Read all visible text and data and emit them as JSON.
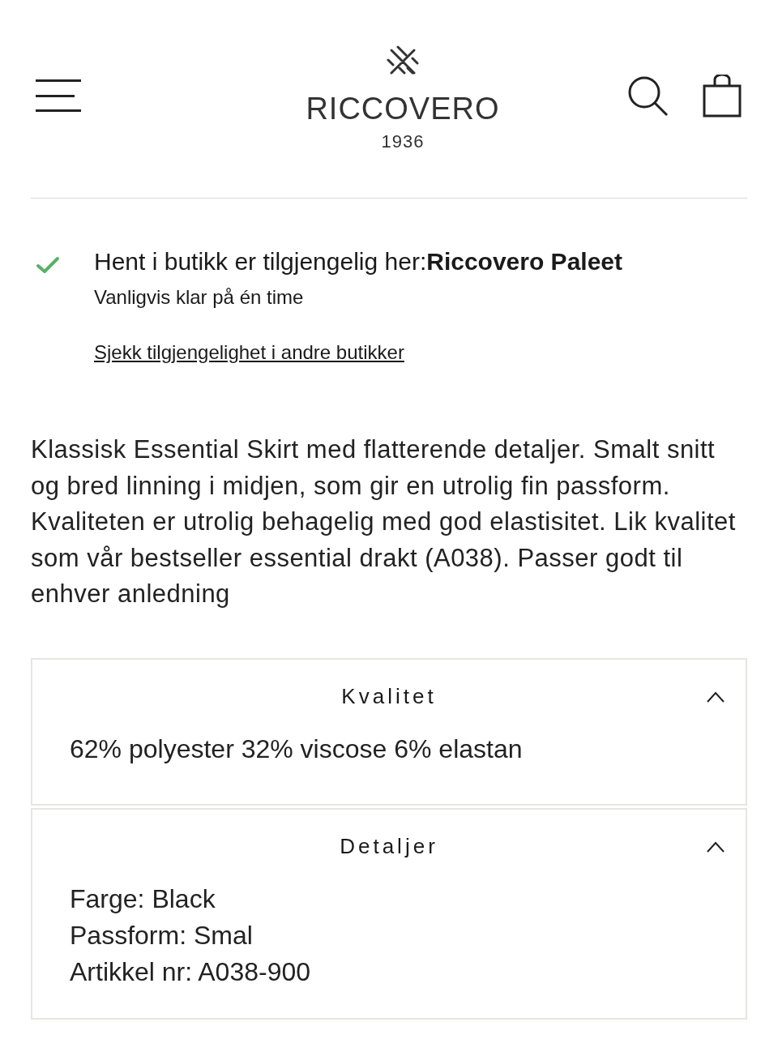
{
  "header": {
    "brand": "RICCOVERO",
    "year": "1936"
  },
  "pickup": {
    "available": true,
    "heading": "Hent i butikk er tilgjengelig her:**Riccovero Paleet**",
    "note": "Vanligvis klar på én time",
    "link": "Sjekk tilgjengelighet i andre butikker"
  },
  "description": "Klassisk Essential Skirt med flatterende detaljer. Smalt snitt og bred linning i midjen, som gir en utrolig fin passform. Kvaliteten er utrolig behagelig med god elastisitet. Lik kvalitet som vår bestseller essential drakt (A038). Passer godt til enhver anledning",
  "accordion": [
    {
      "title": "Kvalitet",
      "expanded": true,
      "lines": [
        "62% polyester 32% viscose 6% elastan"
      ]
    },
    {
      "title": "Detaljer",
      "expanded": true,
      "lines": [
        "Farge: Black",
        "Passform: Smal",
        "Artikkel nr: A038-900"
      ]
    }
  ]
}
